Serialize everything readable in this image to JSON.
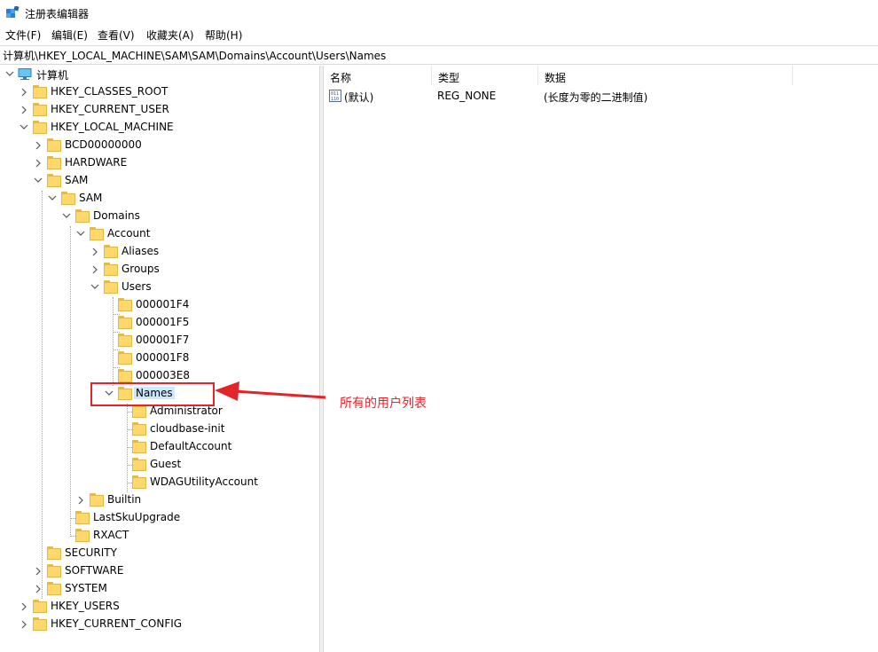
{
  "window": {
    "title": "注册表编辑器"
  },
  "menu": {
    "items": [
      "文件(F)",
      "编辑(E)",
      "查看(V)",
      "收藏夹(A)",
      "帮助(H)"
    ]
  },
  "address": {
    "path": "计算机\\HKEY_LOCAL_MACHINE\\SAM\\SAM\\Domains\\Account\\Users\\Names"
  },
  "tree": {
    "root": "计算机",
    "nodes": [
      "HKEY_CLASSES_ROOT",
      "HKEY_CURRENT_USER",
      "HKEY_LOCAL_MACHINE",
      "BCD00000000",
      "HARDWARE",
      "SAM",
      "SAM",
      "Domains",
      "Account",
      "Aliases",
      "Groups",
      "Users",
      "000001F4",
      "000001F5",
      "000001F7",
      "000001F8",
      "000003E8",
      "Names",
      "Administrator",
      "cloudbase-init",
      "DefaultAccount",
      "Guest",
      "WDAGUtilityAccount",
      "Builtin",
      "LastSkuUpgrade",
      "RXACT",
      "SECURITY",
      "SOFTWARE",
      "SYSTEM",
      "HKEY_USERS",
      "HKEY_CURRENT_CONFIG"
    ]
  },
  "list": {
    "headers": {
      "name": "名称",
      "type": "类型",
      "data": "数据"
    },
    "rows": [
      {
        "name": "(默认)",
        "type": "REG_NONE",
        "data": "(长度为零的二进制值)"
      }
    ]
  },
  "annotation": {
    "text": "所有的用户列表",
    "color": "#e3242b"
  },
  "colors": {
    "selection": "#cce8ff",
    "folder": "#fcd96a",
    "accent": "#e3242b"
  }
}
